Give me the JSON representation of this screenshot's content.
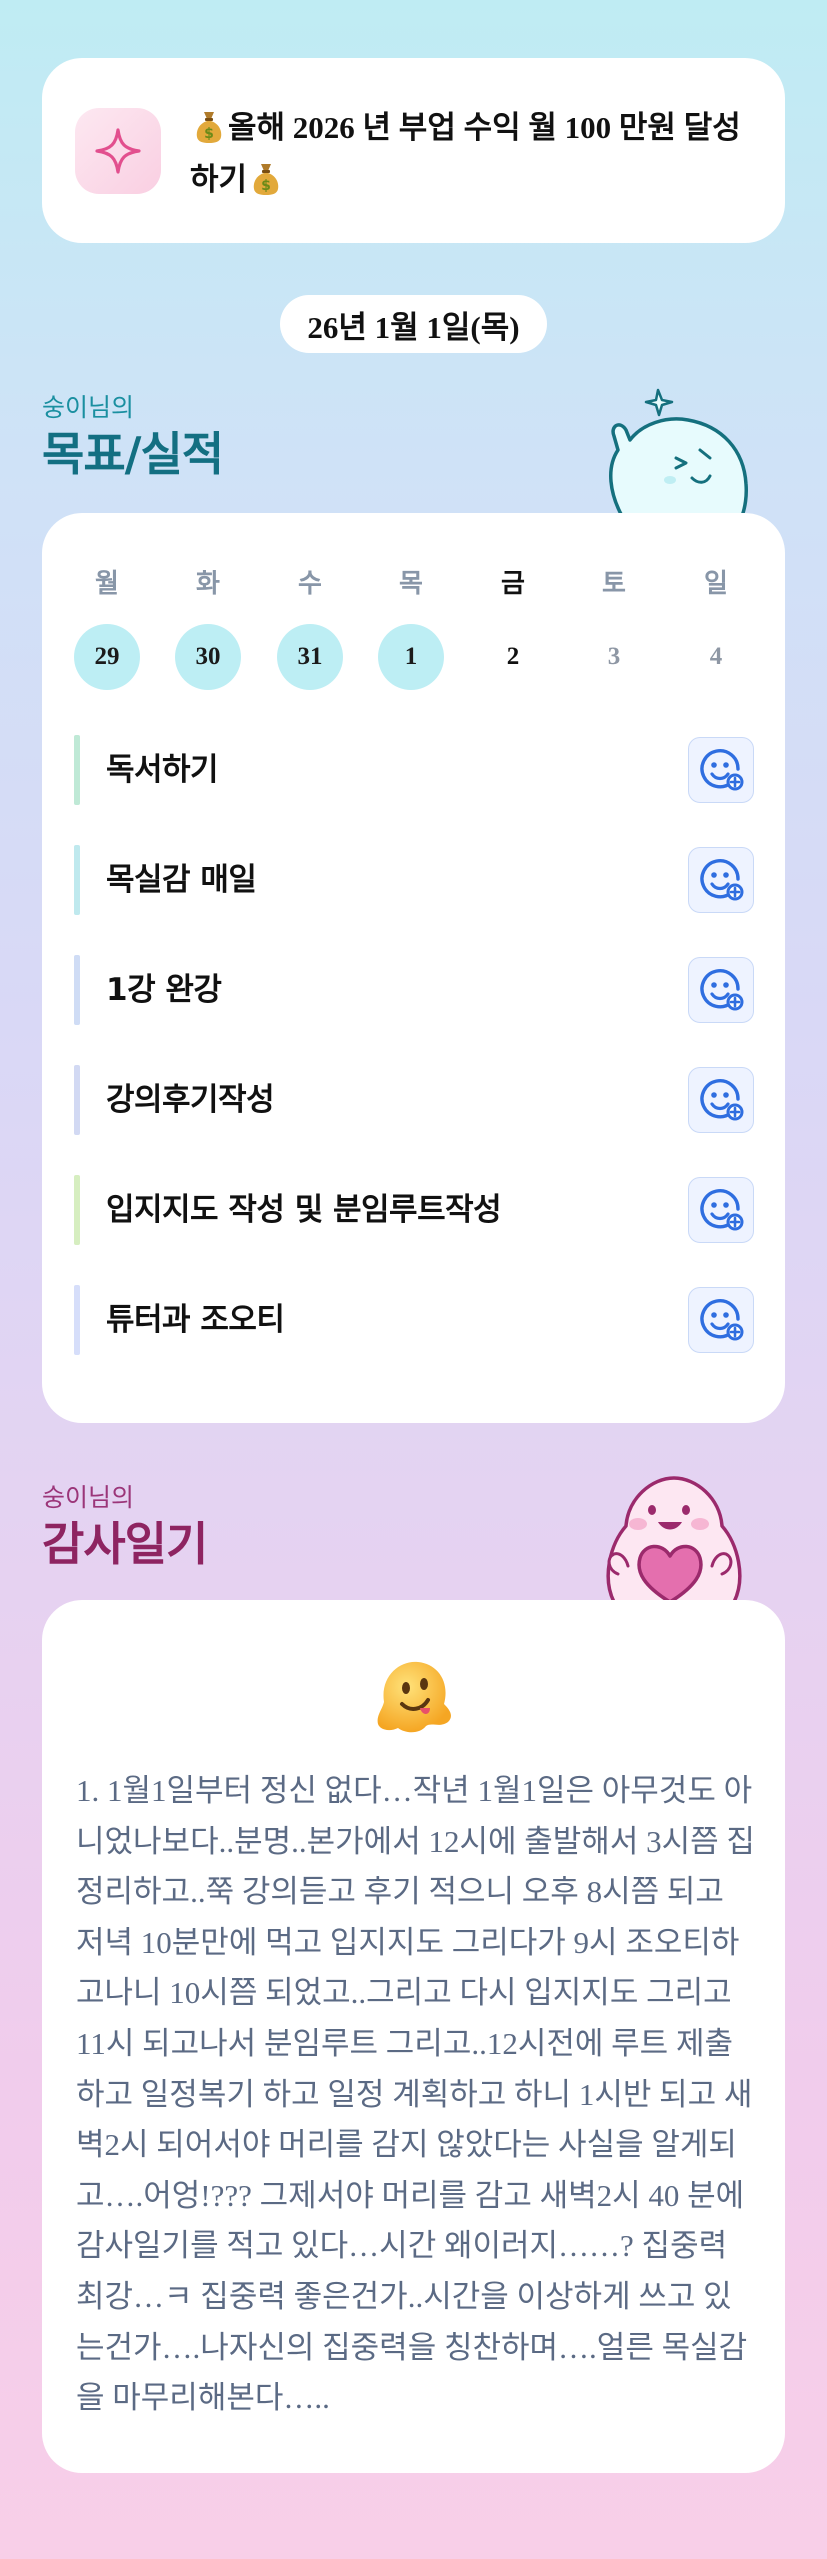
{
  "goal": {
    "title": "올해 2026 년 부업 수익 월 100 만원 달성하기",
    "icon": "sparkle-icon",
    "emoji": "money-bag"
  },
  "date_label": "26년 1월 1일(목)",
  "goals_section": {
    "subtitle": "숭이님의",
    "title": "목표/실적"
  },
  "week": {
    "days": [
      "월",
      "화",
      "수",
      "목",
      "금",
      "토",
      "일"
    ],
    "dates": [
      "29",
      "30",
      "31",
      "1",
      "2",
      "3",
      "4"
    ]
  },
  "tasks": [
    {
      "label": "독서하기",
      "color": "#bfe9d6"
    },
    {
      "label": "목실감 매일",
      "color": "#bfe9ee"
    },
    {
      "label": "1강 완강",
      "color": "#cfdcf5"
    },
    {
      "label": "강의후기작성",
      "color": "#d2d9f3"
    },
    {
      "label": "입지지도 작성 및 분임루트작성",
      "color": "#d6eec0"
    },
    {
      "label": "튜터과 조오티",
      "color": "#d6defa"
    }
  ],
  "gratitude_section": {
    "subtitle": "숭이님의",
    "title": "감사일기"
  },
  "gratitude": {
    "emoji": "melting-face",
    "text": "1. 1월1일부터 정신 없다…작년 1월1일은 아무것도 아니었나보다..분명..본가에서 12시에 출발해서 3시쯤 집 정리하고..쭉 강의듣고 후기 적으니 오후 8시쯤 되고 저녁 10분만에 먹고 입지지도 그리다가 9시 조오티하고나니 10시쯤 되었고..그리고 다시 입지지도 그리고 11시 되고나서 분임루트 그리고..12시전에 루트 제출하고 일정복기 하고 일정 계획하고 하니 1시반 되고 새벽2시 되어서야 머리를 감지 않았다는 사실을 알게되고….어엉!??? 그제서야 머리를 감고 새벽2시 40 분에 감사일기를 적고 있다…시간 왜이러지……? 집중력 최강…ㅋ 집중력 좋은건가..시간을 이상하게 쓰고 있는건가….나자신의 집중력을 칭찬하며….얼른 목실감을 마무리해본다….."
  },
  "colors": {
    "goals_title": "#136f82",
    "gratitude_title": "#9b2a6c",
    "past_date_bg": "#bdeef4"
  }
}
